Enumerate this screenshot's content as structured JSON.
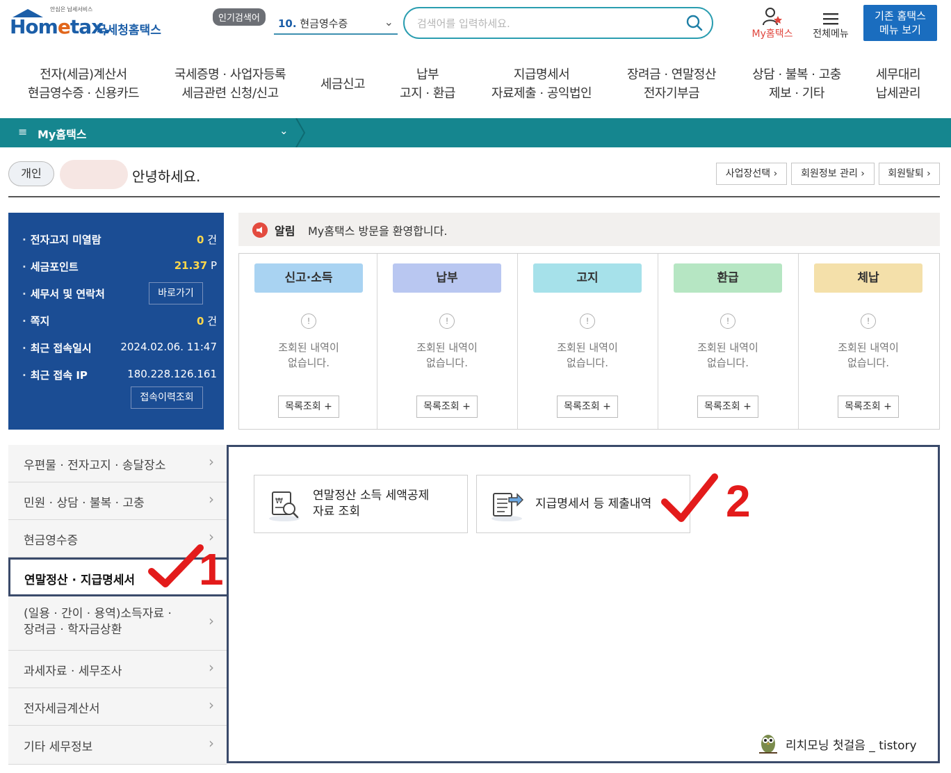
{
  "header": {
    "logo_tagline": "안심은 납세서비스",
    "logo_home": "Hom",
    "logo_e": "e",
    "logo_tax": "tax.",
    "logo_nts": "국세청홈택스",
    "popular_badge": "인기검색어",
    "popular_num": "10.",
    "popular_text": "현금영수증",
    "search_placeholder": "검색어를 입력하세요.",
    "my_hometax": "My홈택스",
    "all_menu": "전체메뉴",
    "legacy_line1": "기존 홈택스",
    "legacy_line2": "메뉴 보기"
  },
  "gnb": [
    {
      "line1": "전자(세금)계산서",
      "line2": "현금영수증 · 신용카드"
    },
    {
      "line1": "국세증명 · 사업자등록",
      "line2": "세금관련 신청/신고"
    },
    {
      "line1": "세금신고",
      "line2": ""
    },
    {
      "line1": "납부",
      "line2": "고지 · 환급"
    },
    {
      "line1": "지급명세서",
      "line2": "자료제출 · 공익법인"
    },
    {
      "line1": "장려금 · 연말정산",
      "line2": "전자기부금"
    },
    {
      "line1": "상담 · 불복 · 고충",
      "line2": "제보 · 기타"
    },
    {
      "line1": "세무대리",
      "line2": "납세관리"
    }
  ],
  "tealbar": {
    "menu_icon": "≡",
    "title": "My홈택스",
    "chevron": "⌄"
  },
  "account": {
    "type": "개인",
    "greeting": "안녕하세요.",
    "buttons": [
      "사업장선택 ›",
      "회원정보 관리 ›",
      "회원탈퇴 ›"
    ]
  },
  "info": {
    "rows": [
      {
        "label": "전자고지 미열람",
        "value": "0",
        "unit": "건"
      },
      {
        "label": "세금포인트",
        "value": "21.37",
        "unit": "P"
      },
      {
        "label": "세무서 및 연락처",
        "value": "",
        "unit": ""
      },
      {
        "label": "쪽지",
        "value": "0",
        "unit": "건"
      },
      {
        "label": "최근 접속일시",
        "value": "2024.02.06.  11:47",
        "unit": ""
      },
      {
        "label": "최근 접속 IP",
        "value": "180.228.126.161",
        "unit": ""
      }
    ],
    "goto_button": "바로가기",
    "history_button": "접속이력조회"
  },
  "alert": {
    "label": "알림",
    "message": "My홈택스 방문을 환영합니다."
  },
  "status_cards": [
    {
      "title": "신고·소득",
      "color": "#a9d3f2",
      "line1": "조회된 내역이",
      "line2": "없습니다.",
      "button": "목록조회 +"
    },
    {
      "title": "납부",
      "color": "#b9c7f1",
      "line1": "조회된 내역이",
      "line2": "없습니다.",
      "button": "목록조회 +"
    },
    {
      "title": "고지",
      "color": "#a6e1ea",
      "line1": "조회된 내역이",
      "line2": "없습니다.",
      "button": "목록조회 +"
    },
    {
      "title": "환급",
      "color": "#b6e6c3",
      "line1": "조회된 내역이",
      "line2": "없습니다.",
      "button": "목록조회 +"
    },
    {
      "title": "체납",
      "color": "#f4e0aa",
      "line1": "조회된 내역이",
      "line2": "없습니다.",
      "button": "목록조회 +"
    }
  ],
  "side_menu": [
    {
      "line1": "우편물 · 전자고지 · 송달장소",
      "line2": "",
      "active": false
    },
    {
      "line1": "민원 · 상담 · 불복 · 고충",
      "line2": "",
      "active": false
    },
    {
      "line1": "현금영수증",
      "line2": "",
      "active": false
    },
    {
      "line1": "연말정산 · 지급명세서",
      "line2": "",
      "active": true
    },
    {
      "line1": "(일용 · 간이 · 용역)소득자료 ·",
      "line2": "장려금 · 학자금상환",
      "active": false
    },
    {
      "line1": "과세자료 · 세무조사",
      "line2": "",
      "active": false
    },
    {
      "line1": "전자세금계산서",
      "line2": "",
      "active": false
    },
    {
      "line1": "기타 세무정보",
      "line2": "",
      "active": false
    }
  ],
  "main_cards": [
    {
      "line1": "연말정산 소득 세액공제",
      "line2": "자료 조회",
      "icon": "doc-search-icon"
    },
    {
      "line1": "지급명세서 등 제출내역",
      "line2": "",
      "icon": "doc-submit-icon"
    }
  ],
  "annotations": {
    "num1": "1",
    "num2": "2",
    "color": "#e31b1b"
  },
  "watermark": "리치모닝 첫걸음 _ tistory"
}
